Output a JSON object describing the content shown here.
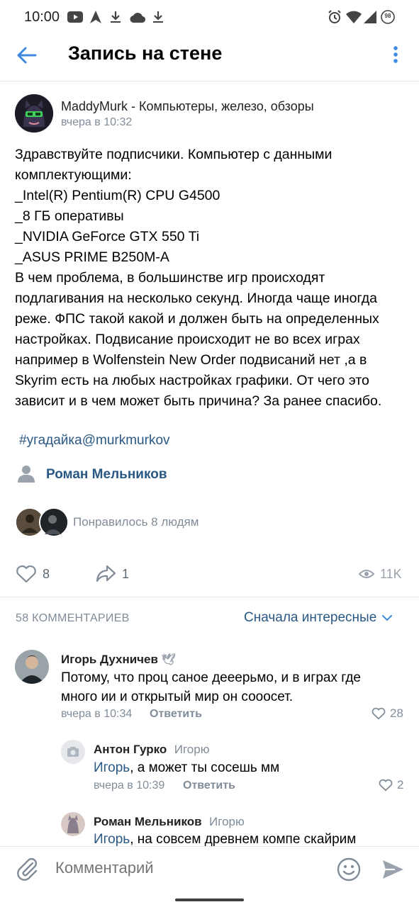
{
  "status": {
    "time": "10:00",
    "battery": "98"
  },
  "header": {
    "title": "Запись на стене"
  },
  "post": {
    "author": "MaddyMurk - Компьютеры, железо, обзоры",
    "time": "вчера в 10:32",
    "text": "Здравствуйте подписчики. Компьютер с данными\nкомплектующими:\n_Intel(R) Pentium(R) CPU G4500\n_8 ГБ оперативы\n_NVIDIA GeForce GTX 550 Ti\n_ASUS PRIME B250M-A\nВ чем проблема, в большинстве игр происходят\nподлагивания на несколько секунд. Иногда чаще иногда\nреже. ФПС такой какой и должен быть на определенных\nнастройках. Подвисание происходит не во всех играх\nнапример в Wolfenstein New Order подвисаний нет ,а в\nSkyrim есть на любых настройках графики. От чего это\nзависит и в чем может быть причина? За ранее спасибо.",
    "hashtag": "#угадайка@murkmurkov",
    "signer": "Роман Мельников",
    "liked_by": "Понравилось 8 людям",
    "likes": "8",
    "shares": "1",
    "views": "11K"
  },
  "comments_section": {
    "count_label": "58 КОММЕНТАРИЕВ",
    "sort_label": "Сначала интересные"
  },
  "comments": [
    {
      "name": "Игорь Духничев",
      "badge": "🕊",
      "text": "Потому, что проц саное дееерьмо, и в играх где\nмного ии и открытый мир он сооосет.",
      "time": "вчера в 10:34",
      "reply": "Ответить",
      "likes": "28"
    },
    {
      "name": "Антон Гурко",
      "reply_to": "Игорю",
      "mention": "Игорь",
      "text": ", а может ты сосешь мм",
      "time": "вчера в 10:39",
      "reply": "Ответить",
      "likes": "2"
    },
    {
      "name": "Роман Мельников",
      "reply_to": "Игорю",
      "mention": "Игорь",
      "text": ", на совсем древнем компе скайрим"
    }
  ],
  "composer": {
    "placeholder": "Комментарий"
  },
  "colors": {
    "accent": "#2a5885",
    "icon": "#818c99",
    "back": "#3f8ae0"
  }
}
